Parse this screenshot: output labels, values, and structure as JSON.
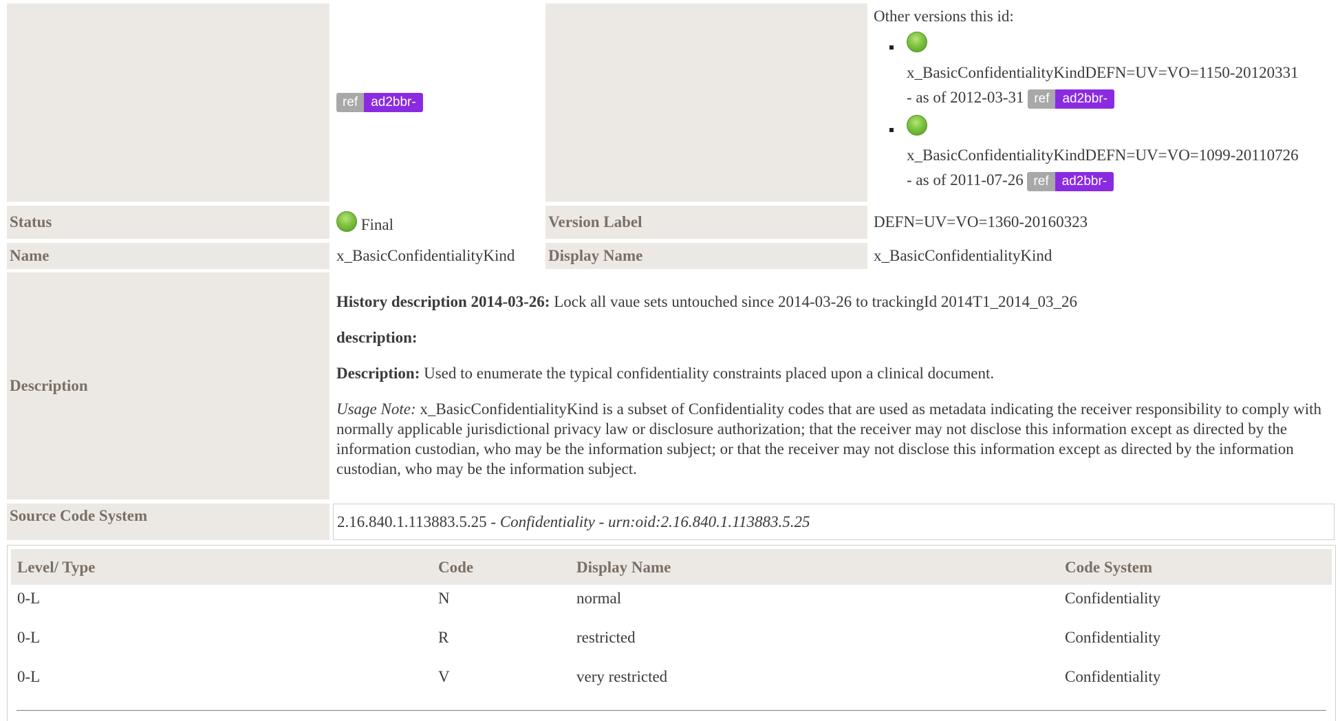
{
  "header_row": {
    "badge_ref": "ref",
    "badge_id": "ad2bbr-",
    "other_versions_label": "Other versions this id:",
    "versions": [
      {
        "id": "x_BasicConfidentialityKindDEFN=UV=VO=1150-20120331",
        "as_of": "- as of 2012-03-31",
        "badge_ref": "ref",
        "badge_id": "ad2bbr-"
      },
      {
        "id": "x_BasicConfidentialityKindDEFN=UV=VO=1099-20110726",
        "as_of": "- as of 2011-07-26",
        "badge_ref": "ref",
        "badge_id": "ad2bbr-"
      }
    ]
  },
  "status": {
    "label": "Status",
    "value": "Final",
    "icon": "green-status-dot-icon"
  },
  "version_label": {
    "label": "Version Label",
    "value": "DEFN=UV=VO=1360-20160323"
  },
  "name": {
    "label": "Name",
    "value": "x_BasicConfidentialityKind"
  },
  "display_name": {
    "label": "Display Name",
    "value": "x_BasicConfidentialityKind"
  },
  "description": {
    "label": "Description",
    "history_title": "History description 2014-03-26:",
    "history_text": " Lock all vaue sets untouched since 2014-03-26 to trackingId 2014T1_2014_03_26",
    "desc_title": "description:",
    "description_title": "Description:",
    "description_text": " Used to enumerate the typical confidentiality constraints placed upon a clinical document.",
    "usage_title": "Usage Note:",
    "usage_text": " x_BasicConfidentialityKind is a subset of Confidentiality codes that are used as metadata indicating the receiver responsibility to comply with normally applicable jurisdictional privacy law or disclosure authorization; that the receiver may not disclose this information except as directed by the information custodian, who may be the information subject; or that the receiver may not disclose this information except as directed by the information custodian, who may be the information subject."
  },
  "source_code_system": {
    "label": "Source Code System",
    "oid": "2.16.840.1.113883.5.25",
    "sep1": " - ",
    "name": "Confidentiality",
    "sep2": " - ",
    "urn": "urn:oid:2.16.840.1.113883.5.25"
  },
  "code_table": {
    "headers": [
      "Level/ Type",
      "Code",
      "Display Name",
      "Code System"
    ],
    "rows": [
      {
        "level": "0-L",
        "code": "N",
        "display": "normal",
        "system": "Confidentiality"
      },
      {
        "level": "0-L",
        "code": "R",
        "display": "restricted",
        "system": "Confidentiality"
      },
      {
        "level": "0-L",
        "code": "V",
        "display": "very restricted",
        "system": "Confidentiality"
      }
    ]
  },
  "colors": {
    "label_bg": "#ece9e5",
    "label_text": "#7a6f64",
    "badge_ref": "#a8a8a8",
    "badge_id": "#8a2be2",
    "status_green": "#7cc23f"
  }
}
